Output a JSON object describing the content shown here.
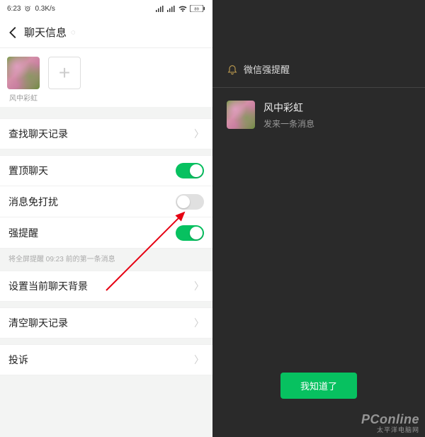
{
  "status": {
    "time": "6:23",
    "alarm": true,
    "speed": "0.3K/s",
    "signal": "ˢⁱᵐ",
    "battery": "89"
  },
  "header": {
    "title": "聊天信息"
  },
  "contact": {
    "name": "风中彩虹"
  },
  "settings": {
    "search_history": "查找聊天记录",
    "pin_chat": "置顶聊天",
    "pin_on": true,
    "mute": "消息免打扰",
    "mute_on": false,
    "strong_alert": "强提醒",
    "strong_alert_on": true,
    "strong_alert_hint": "将全屏提醒 09:23 前的第一条消息",
    "set_background": "设置当前聊天背景",
    "clear_history": "清空聊天记录",
    "complaint": "投诉"
  },
  "alert_screen": {
    "title": "微信强提醒",
    "name": "风中彩虹",
    "message": "发来一条消息",
    "ok": "我知道了"
  },
  "watermark": {
    "line1": "PConline",
    "line2": "太平洋电脑网"
  }
}
